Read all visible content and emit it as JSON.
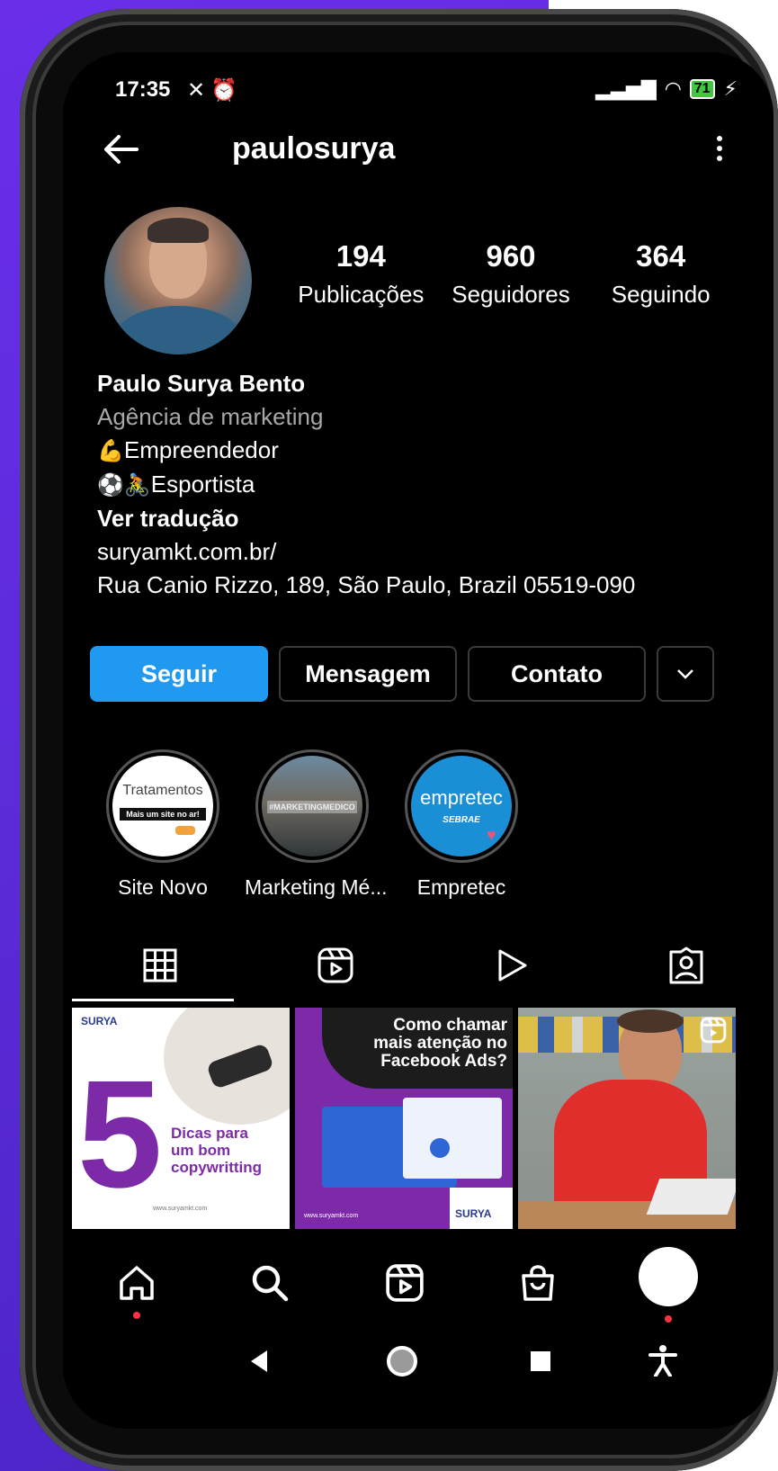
{
  "status": {
    "time": "17:35",
    "battery": "71"
  },
  "header": {
    "username": "paulosurya"
  },
  "profile": {
    "stats": [
      {
        "num": "194",
        "label": "Publicações"
      },
      {
        "num": "960",
        "label": "Seguidores"
      },
      {
        "num": "364",
        "label": "Seguindo"
      }
    ],
    "name": "Paulo Surya Bento",
    "category": "Agência de marketing",
    "bio1": "Empreendedor",
    "bio2": "Esportista",
    "translate": "Ver tradução",
    "link": "suryamkt.com.br/",
    "address": "Rua Canio Rizzo, 189, São Paulo, Brazil 05519-090"
  },
  "actions": {
    "follow": "Seguir",
    "message": "Mensagem",
    "contact": "Contato"
  },
  "highlights": [
    {
      "label": "Site Novo",
      "cover_title": "Tratamentos",
      "cover_sub": "Mais um site no ar!"
    },
    {
      "label": "Marketing Mé...",
      "cover_title": "#MARKETINGMEDICO"
    },
    {
      "label": "Empretec",
      "cover_title": "empretec",
      "cover_sub": "SEBRAE"
    }
  ],
  "posts": [
    {
      "brand": "SURYA",
      "big": "5",
      "text1": "Dicas para",
      "text2": "um bom",
      "text3": "copywritting",
      "footer": "www.suryamkt.com"
    },
    {
      "heading1": "Como chamar",
      "heading2": "mais atenção no",
      "heading3": "Facebook Ads?",
      "footer": "www.suryamkt.com",
      "brand": "SURYA"
    },
    {
      "type": "video"
    }
  ],
  "colors": {
    "follow_btn": "#1f9af0",
    "purple": "#5b2bd9",
    "accent": "#ff3040"
  }
}
